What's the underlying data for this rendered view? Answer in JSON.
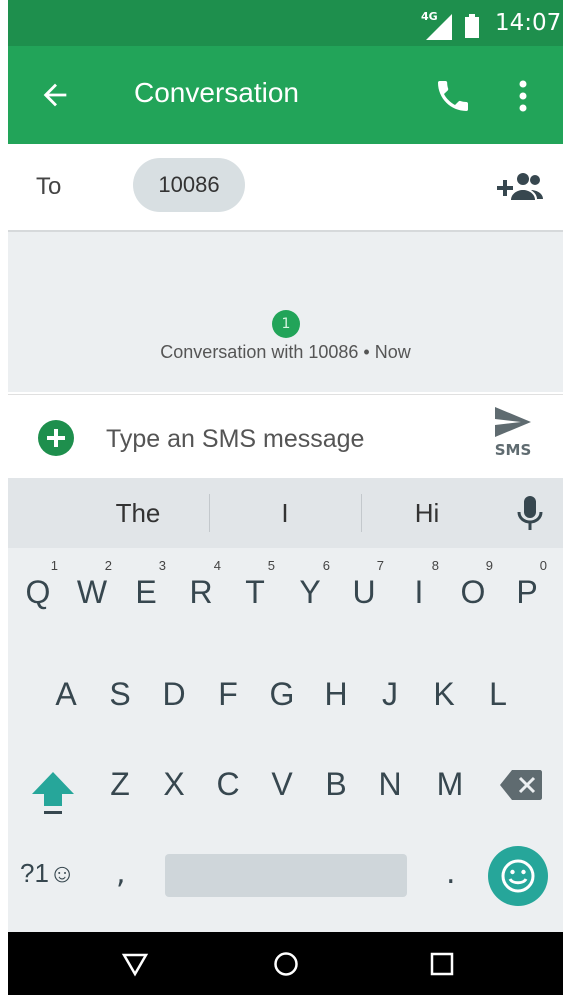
{
  "status_bar": {
    "network": "4G",
    "time": "14:07"
  },
  "app_bar": {
    "title": "Conversation"
  },
  "recipients": {
    "to_label": "To",
    "chip": "10086"
  },
  "conversation": {
    "badge": "1",
    "text": "Conversation with 10086 • Now"
  },
  "compose": {
    "placeholder": "Type an SMS message",
    "send_label": "SMS"
  },
  "keyboard": {
    "suggestions": [
      "The",
      "I",
      "Hi"
    ],
    "row1": [
      {
        "key": "Q",
        "hint": "1"
      },
      {
        "key": "W",
        "hint": "2"
      },
      {
        "key": "E",
        "hint": "3"
      },
      {
        "key": "R",
        "hint": "4"
      },
      {
        "key": "T",
        "hint": "5"
      },
      {
        "key": "Y",
        "hint": "6"
      },
      {
        "key": "U",
        "hint": "7"
      },
      {
        "key": "I",
        "hint": "8"
      },
      {
        "key": "O",
        "hint": "9"
      },
      {
        "key": "P",
        "hint": "0"
      }
    ],
    "row2": [
      "A",
      "S",
      "D",
      "F",
      "G",
      "H",
      "J",
      "K",
      "L"
    ],
    "row3": [
      "Z",
      "X",
      "C",
      "V",
      "B",
      "N",
      "M"
    ],
    "symbols": "?1☺",
    "comma": ",",
    "period": "."
  },
  "colors": {
    "status_bar": "#1e8f4d",
    "app_bar": "#22a459",
    "accent": "#26a69a",
    "keyboard_bg": "#eceff1"
  }
}
